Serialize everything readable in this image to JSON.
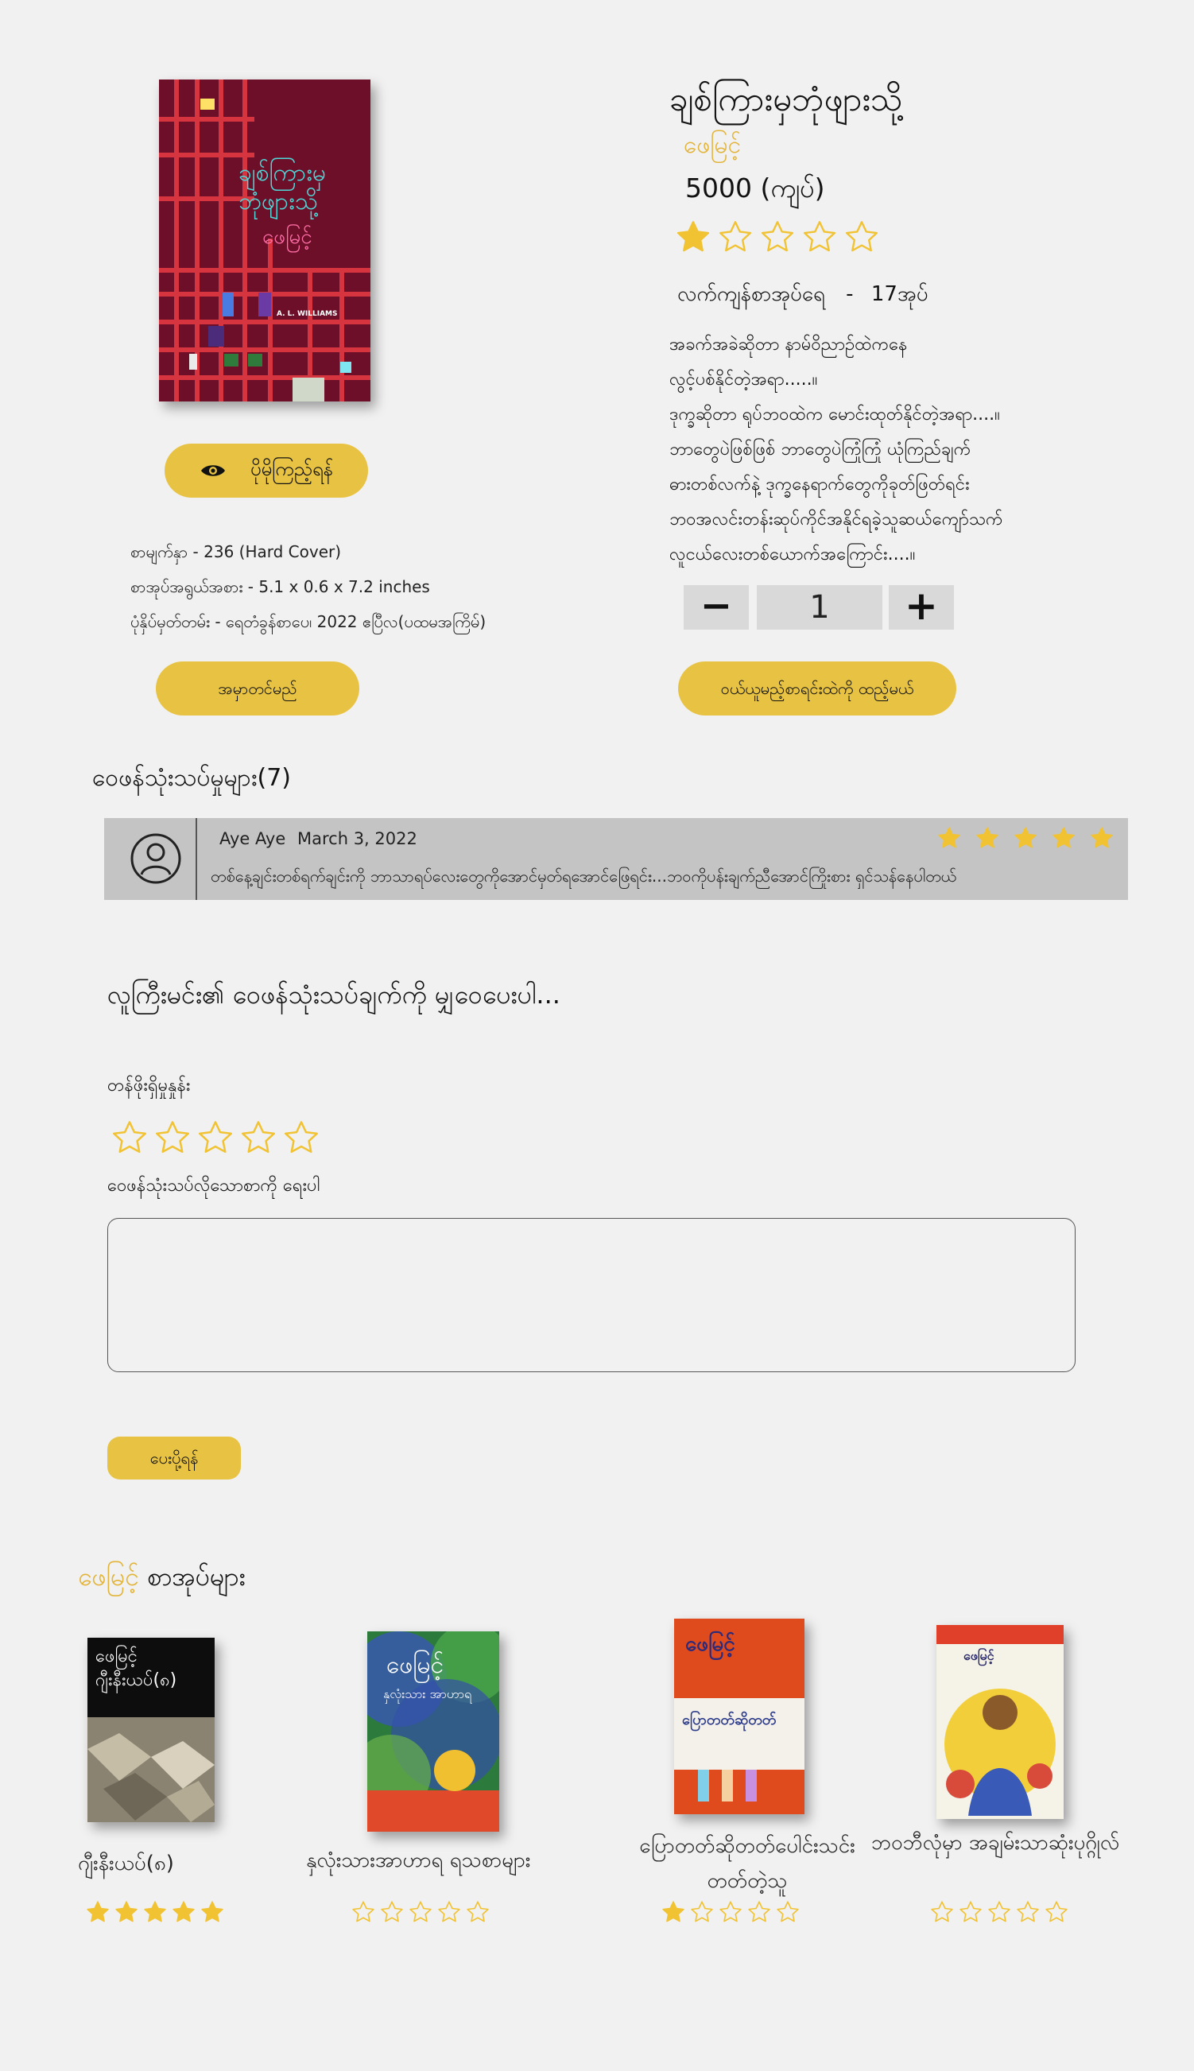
{
  "book": {
    "title": "ချစ်ကြားမှဘုံဖျားသို့",
    "author": "ဖေမြင့်",
    "price": "5000 (ကျပ်)",
    "rating": 1,
    "stock_label": "လက်ကျန်စာအုပ်ရေ",
    "stock_sep": "-",
    "stock_count": "17အုပ်",
    "description": [
      "အခက်အခဲဆိုတာ နာမ်ဝိညာဉ်ထဲကနေ",
      "လွင့်ပစ်နိုင်တဲ့အရာ.....။",
      "ဒုက္ခဆိုတာ ရုပ်ဘဝထဲက မောင်းထုတ်နိုင်တဲ့အရာ....။",
      "ဘာတွေပဲဖြစ်ဖြစ် ဘာတွေပဲကြုံကြုံ ယုံကြည်ချက်",
      "ဓားတစ်လက်နဲ့ ဒုက္ခနေရာက်တွေကိုခုတ်ဖြတ်ရင်း",
      "ဘဝအလင်းတန်းဆုပ်ကိုင်အနိုင်ရခဲ့သူဆယ်ကျော်သက်",
      "လူငယ်လေးတစ်ယောက်အကြောင်း....။"
    ],
    "quantity": "1",
    "qty_minus": "−",
    "qty_plus": "+",
    "cart_button": "ဝယ်ယူမည့်စာရင်းထဲကို ထည့်မယ်",
    "preview_button": "ပိုမိုကြည့်ရန်",
    "order_button": "အမှာတင်မည်",
    "cover_author": "ဖေမြင့်",
    "cover_title_1": "ချစ်ကြားမှ",
    "cover_title_2": "ဘုံဖျားသို့",
    "cover_english": "A. L. WILLIAMS",
    "specs": [
      "စာမျက်နှာ - 236 (Hard Cover)",
      "စာအုပ်အရွယ်အစား  -  5.1 x 0.6 x 7.2 inches",
      "ပုံနှိပ်မှတ်တမ်း  -  ရေတံခွန်စာပေ၊ 2022 ဧပြီလ(ပထမအကြိမ်)"
    ]
  },
  "reviews": {
    "heading": "ဝေဖန်သုံးသပ်မှုများ(7)",
    "items": [
      {
        "name": "Aye Aye",
        "date": "March 3, 2022",
        "rating": 5,
        "text": "တစ်နေ့ချင်းတစ်ရက်ချင်းကို ဘာသာရပ်လေးတွေကိုအောင်မှတ်ရအောင်ဖြေရင်း...ဘဝကိုပန်းချက်ညီအောင်ကြိုးစား ရှင်သန်နေပါတယ်"
      }
    ]
  },
  "review_form": {
    "prompt": "လူကြီးမင်း၏ ဝေဖန်သုံးသပ်ချက်ကို မျှဝေပေးပါ...",
    "rating_label": "တန်ဖိုးရှိမှုနှုန်း",
    "comment_label": "ဝေဖန်သုံးသပ်လိုသောစာကို ရေးပါ",
    "comment_value": "",
    "submit_button": "ပေးပို့ရန်"
  },
  "author_books": {
    "heading_author": "ဖေမြင့်",
    "heading_suffix": " စာအုပ်များ",
    "items": [
      {
        "title": "ဂျီးနီးယပ်(၈)",
        "rating": 5,
        "cover_author": "ဖေမြင့်",
        "cover_title": "ဂျီးနီးယပ်(၈)"
      },
      {
        "title": "နှလုံးသားအာဟာရ ရသစာများ",
        "rating": 0,
        "cover_author": "ဖေမြင့်",
        "cover_title": "နှလုံးသား အာဟာရ"
      },
      {
        "title": "ပြောတတ်ဆိုတတ်ပေါင်းသင်း တတ်တဲ့သူ",
        "rating": 1,
        "cover_author": "ဖေမြင့်",
        "cover_title": "ပြောတတ်ဆိုတတ်"
      },
      {
        "title": "ဘဝဘီလုံမှာ အချမ်းသာဆုံးပုဂ္ဂိုလ်",
        "rating": 0,
        "cover_author": "ဖေမြင့်",
        "cover_title": ""
      }
    ]
  },
  "colors": {
    "accent": "#e8c343",
    "author": "#e3b43a",
    "star": "#f1c232",
    "review_bg": "#c4c4c4"
  },
  "icons": {
    "eye": "eye-icon",
    "user": "user-avatar-icon",
    "star": "star-icon"
  }
}
